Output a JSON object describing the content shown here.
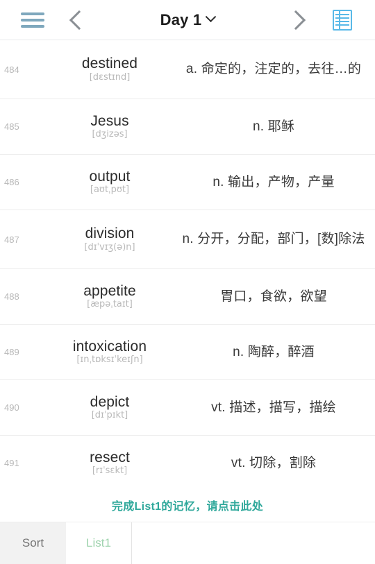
{
  "topbar": {
    "menu_icon": "hamburger-menu-icon",
    "prev_icon": "chevron-left-icon",
    "title": "Day 1",
    "title_caret_icon": "chevron-down-icon",
    "next_icon": "chevron-right-icon",
    "grid_icon": "table-view-icon"
  },
  "words": [
    {
      "index": "484",
      "word": "destined",
      "phonetic": "[dɛstɪnd]",
      "definition": "a. 命定的，注定的，去往…的"
    },
    {
      "index": "485",
      "word": "Jesus",
      "phonetic": "[dʒizəs]",
      "definition": "n. 耶稣"
    },
    {
      "index": "486",
      "word": "output",
      "phonetic": "[aʊtˌpʊt]",
      "definition": "n. 输出，产物，产量"
    },
    {
      "index": "487",
      "word": "division",
      "phonetic": "[dɪˈvɪʒ(ə)n]",
      "definition": "n. 分开，分配，部门，[数]除法"
    },
    {
      "index": "488",
      "word": "appetite",
      "phonetic": "[æpəˌtaɪt]",
      "definition": "胃口，食欲，欲望"
    },
    {
      "index": "489",
      "word": "intoxication",
      "phonetic": "[ɪnˌtɒksɪˈkeɪʃn]",
      "definition": "n. 陶醉，醉酒"
    },
    {
      "index": "490",
      "word": "depict",
      "phonetic": "[dɪˈpɪkt]",
      "definition": "vt. 描述，描写，描绘"
    },
    {
      "index": "491",
      "word": "resect",
      "phonetic": "[rɪˈsɛkt]",
      "definition": "vt. 切除，割除"
    }
  ],
  "footer": {
    "prompt": "完成List1的记忆，请点击此处",
    "prompt_color": "#2fa89b"
  },
  "tabbar": {
    "sort_label": "Sort",
    "list_label": "List1"
  },
  "colors": {
    "menu_icon": "#7fa8bd",
    "grid_icon": "#59b9e8",
    "teal_link": "#2fa89b",
    "tab_active_text": "#9fd3ae"
  }
}
